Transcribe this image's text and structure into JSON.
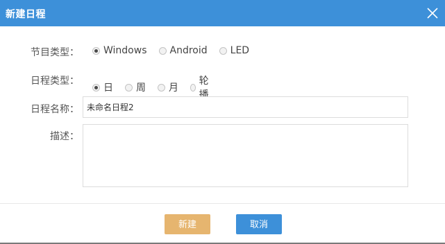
{
  "dialog": {
    "title": "新建日程",
    "close_icon": "close-icon"
  },
  "form": {
    "program_type": {
      "label": "节目类型：",
      "options": [
        "Windows",
        "Android",
        "LED"
      ],
      "selected": "Windows"
    },
    "schedule_type": {
      "label": "日程类型：",
      "options": [
        "日",
        "周",
        "月",
        "轮播"
      ],
      "selected": "日"
    },
    "schedule_name": {
      "label": "日程名称：",
      "value": "未命名日程2"
    },
    "description": {
      "label": "描述：",
      "value": ""
    }
  },
  "buttons": {
    "create": "新建",
    "cancel": "取消"
  },
  "colors": {
    "titlebar": "#3d90d9",
    "create_button": "#e6b56f",
    "cancel_button": "#3d90d9"
  }
}
